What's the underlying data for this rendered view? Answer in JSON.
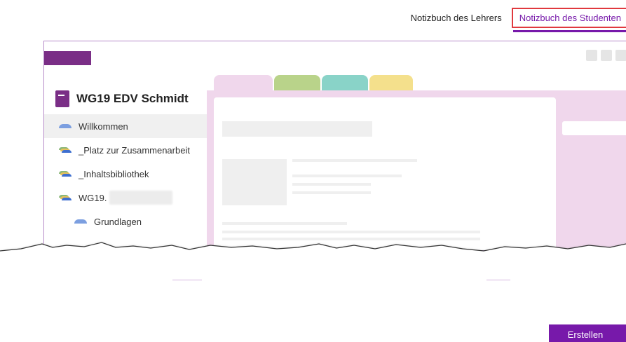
{
  "tabs": {
    "teacher_label": "Notizbuch des Lehrers",
    "student_label": "Notizbuch des Studenten"
  },
  "notebook": {
    "title": "WG19 EDV Schmidt",
    "sections": [
      {
        "label": "Willkommen",
        "icon": "section-icon",
        "selected": true
      },
      {
        "label": "_Platz zur Zusammenarbeit",
        "icon": "section-group-icon"
      },
      {
        "label": "_Inhaltsbibliothek",
        "icon": "section-group-icon"
      },
      {
        "label": "WG19.",
        "icon": "section-group-icon"
      },
      {
        "label": "Grundlagen",
        "icon": "section-icon"
      }
    ],
    "tab_colors": [
      "#f0d7ec",
      "#b9d38a",
      "#89d3c8",
      "#f4e08c"
    ]
  },
  "actions": {
    "create_label": "Erstellen"
  },
  "colors": {
    "accent": "#7719aa",
    "highlight_border": "#e0393e",
    "notebook_purple": "#7a2e86"
  }
}
